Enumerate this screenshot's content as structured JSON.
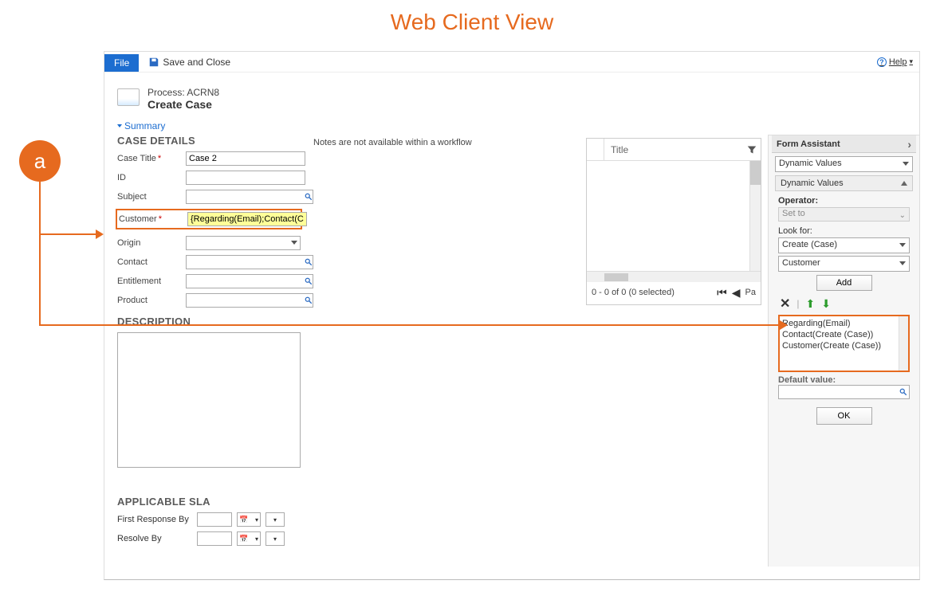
{
  "page_heading": "Web Client View",
  "annotation_badge": "a",
  "topbar": {
    "file_label": "File",
    "save_close_label": "Save and Close",
    "help_label": "Help"
  },
  "process": {
    "prefix": "Process:",
    "name": "ACRN8",
    "title": "Create Case"
  },
  "summary_link": "Summary",
  "case_details": {
    "section_title": "CASE DETAILS",
    "fields": {
      "case_title": {
        "label": "Case Title",
        "value": "Case 2",
        "required": true
      },
      "id": {
        "label": "ID",
        "value": ""
      },
      "subject": {
        "label": "Subject",
        "value": ""
      },
      "customer": {
        "label": "Customer",
        "value": "{Regarding(Email);Contact(Cr",
        "required": true
      },
      "origin": {
        "label": "Origin",
        "value": ""
      },
      "contact": {
        "label": "Contact",
        "value": ""
      },
      "entitlement": {
        "label": "Entitlement",
        "value": ""
      },
      "product": {
        "label": "Product",
        "value": ""
      }
    }
  },
  "description": {
    "section_title": "DESCRIPTION"
  },
  "sla": {
    "section_title": "APPLICABLE SLA",
    "first_response_label": "First Response By",
    "resolve_label": "Resolve By"
  },
  "notes_hint": "Notes are not available within a workflow",
  "grid": {
    "title_column": "Title",
    "footer_status": "0 - 0 of 0 (0 selected)",
    "page_label": "Pa"
  },
  "form_assistant": {
    "header": "Form Assistant",
    "main_select": "Dynamic Values",
    "sub_header": "Dynamic Values",
    "operator_label": "Operator:",
    "operator_value": "Set to",
    "look_for_label": "Look for:",
    "look_for_entity": "Create (Case)",
    "look_for_field": "Customer",
    "add_btn": "Add",
    "list_items": [
      "Regarding(Email)",
      "Contact(Create (Case))",
      "Customer(Create (Case))"
    ],
    "default_label": "Default value:",
    "ok_btn": "OK"
  }
}
